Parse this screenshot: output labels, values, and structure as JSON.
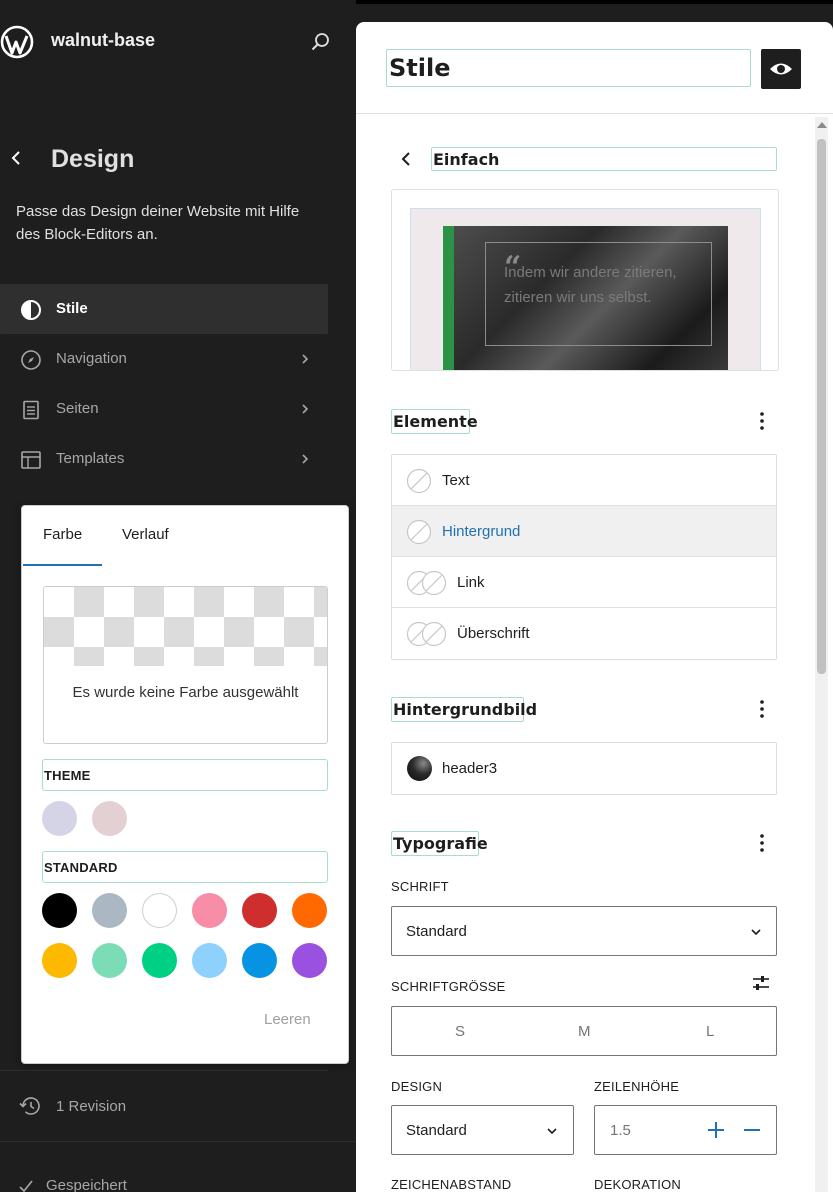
{
  "header": {
    "site_name": "walnut-base",
    "section_title": "Design",
    "section_description": "Passe das Design deiner Website mit Hilfe des Block-Editors an."
  },
  "nav": {
    "items": [
      {
        "label": "Stile",
        "icon": "half-circle-icon",
        "active": true
      },
      {
        "label": "Navigation",
        "icon": "compass-icon"
      },
      {
        "label": "Seiten",
        "icon": "page-icon"
      },
      {
        "label": "Templates",
        "icon": "layout-icon"
      }
    ]
  },
  "footer": {
    "revision_label": "1 Revision",
    "saved_label": "Gespeichert"
  },
  "color_popover": {
    "tabs": [
      "Farbe",
      "Verlauf"
    ],
    "active_tab": "Farbe",
    "no_color_text": "Es wurde keine Farbe ausgewählt",
    "theme_heading": "THEME",
    "theme_colors": [
      "#d5d3e6",
      "#e3d0d2"
    ],
    "standard_heading": "STANDARD",
    "standard_colors": [
      "#000000",
      "#abb8c3",
      "#ffffff",
      "#f78da7",
      "#cf2e2e",
      "#ff6900",
      "#fcb900",
      "#7bdcb5",
      "#00d084",
      "#8ed1fc",
      "#0693e3",
      "#9b51e0"
    ],
    "clear_label": "Leeren"
  },
  "editor": {
    "title": "Stile",
    "variation_name": "Einfach",
    "preview_quote": "Indem wir andere zitieren, zitieren wir uns selbst.",
    "elements_title": "Elemente",
    "elements": [
      {
        "label": "Text",
        "icon": "color-indicator-icon"
      },
      {
        "label": "Hintergrund",
        "icon": "color-indicator-icon",
        "active": true
      },
      {
        "label": "Link",
        "icon": "double-color-indicator-icon"
      },
      {
        "label": "Überschrift",
        "icon": "double-color-indicator-icon"
      }
    ],
    "background_image_title": "Hintergrundbild",
    "background_image_name": "header3",
    "typography_title": "Typografie",
    "font_label": "SCHRIFT",
    "font_value": "Standard",
    "font_size_label": "SCHRIFTGRÖSSE",
    "font_sizes": [
      "S",
      "M",
      "L"
    ],
    "design_label": "DESIGN",
    "design_value": "Standard",
    "line_height_label": "ZEILENHÖHE",
    "line_height_value": "1.5",
    "letter_spacing_label": "ZEICHENABSTAND",
    "decoration_label": "DEKORATION"
  }
}
